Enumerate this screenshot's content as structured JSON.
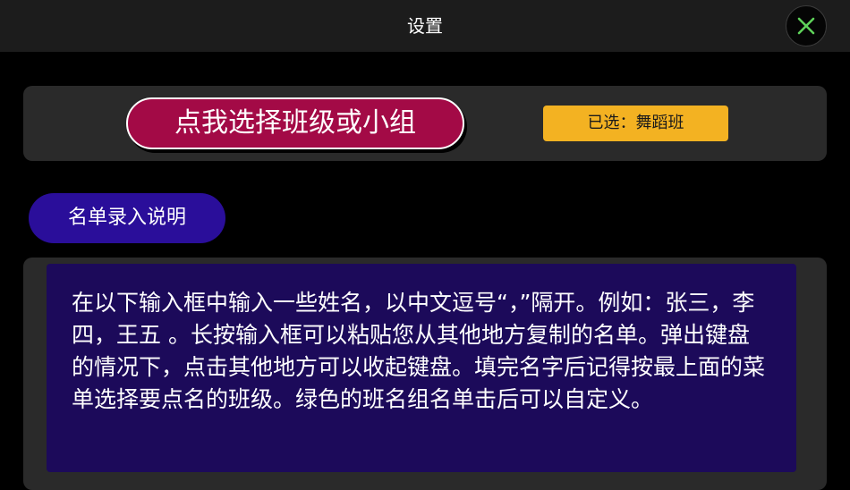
{
  "nav": {
    "title": "设置",
    "close_icon": "close-x-icon",
    "close_color": "#5fd35a"
  },
  "class_selector": {
    "button_label": "点我选择班级或小组",
    "selected_label": "已选：舞蹈班"
  },
  "instructions": {
    "button_label": "名单录入说明",
    "text": "在以下输入框中输入一些姓名，以中文逗号“，”隔开。例如：张三，李四，王五 。长按输入框可以粘贴您从其他地方复制的名单。弹出键盘的情况下，点击其他地方可以收起键盘。填完名字后记得按最上面的菜单选择要点名的班级。绿色的班名组名单击后可以自定义。"
  },
  "colors": {
    "primary_button": "#a30a46",
    "badge": "#f3b222",
    "instruction_button": "#2a0e9a",
    "instruction_box": "#1c0a5a"
  }
}
